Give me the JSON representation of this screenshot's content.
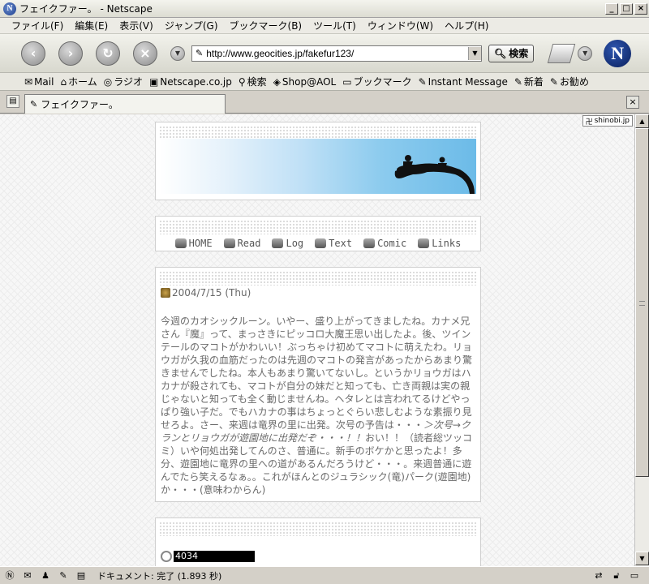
{
  "window": {
    "title": "フェイクファー。 - Netscape",
    "minimize": "_",
    "maximize": "□",
    "close": "×"
  },
  "menu": [
    "ファイル(F)",
    "編集(E)",
    "表示(V)",
    "ジャンプ(G)",
    "ブックマーク(B)",
    "ツール(T)",
    "ウィンドウ(W)",
    "ヘルプ(H)"
  ],
  "nav": {
    "url": "http://www.geocities.jp/fakefur123/",
    "search_label": "検索"
  },
  "personal_toolbar": [
    {
      "icon": "mail-icon",
      "label": "Mail"
    },
    {
      "icon": "home-icon",
      "label": "ホーム"
    },
    {
      "icon": "radio-icon",
      "label": "ラジオ"
    },
    {
      "icon": "my-netscape-icon",
      "label": "Netscape.co.jp"
    },
    {
      "icon": "search-icon",
      "label": "検索"
    },
    {
      "icon": "shop-icon",
      "label": "Shop@AOL"
    },
    {
      "icon": "bookmark-folder-icon",
      "label": "ブックマーク"
    },
    {
      "icon": "link-icon",
      "label": "Instant Message"
    },
    {
      "icon": "link-icon",
      "label": "新着"
    },
    {
      "icon": "link-icon",
      "label": "お勧め"
    }
  ],
  "tab": {
    "title": "フェイクファー。"
  },
  "page": {
    "shinobi_label": "shinobi.jp",
    "nav_links": [
      "HOME",
      "Read",
      "Log",
      "Text",
      "Comic",
      "Links"
    ],
    "entry": {
      "date": "2004/7/15 (Thu)",
      "body_p1": "今週のカオシックルーン。いやー、盛り上がってきましたね。カナメ兄さん『魔』って、まっさきにピッコロ大魔王思い出したよ。後、ツインテールのマコトがかわいい！ぶっちゃけ初めてマコトに萌えたわ。リョウガが久我の血筋だったのは先週のマコトの発言があったからあまり驚きませんでしたね。本人もあまり驚いてないし。というかリョウガはハカナが殺されても、マコトが自分の妹だと知っても、亡き両親は実の親じゃないと知っても全く動じませんね。ヘタレとは言われてるけどやっぱり強い子だ。でもハカナの事はちょっとぐらい悲しむような素振り見せろよ。さー、来週は竜界の里に出発。次号の予告は・・・",
      "body_em": "＞次号→クランとリョウガが遊園地に出発だぞ・・・！！",
      "body_p2": "おい！！（読者総ツッコミ）いや何処出発してんのさ、普通に。新手のボケかと思ったよ！多分、遊園地に竜界の里への道があるんだろうけど・・・。来週普通に遊んでたら笑えるなぁ。。これがほんとのジュラシック(竜)パーク(遊園地)か・・・(意味わからん)"
    },
    "counter": "4034"
  },
  "status": {
    "text": "ドキュメント: 完了 (1.893 秒)"
  }
}
